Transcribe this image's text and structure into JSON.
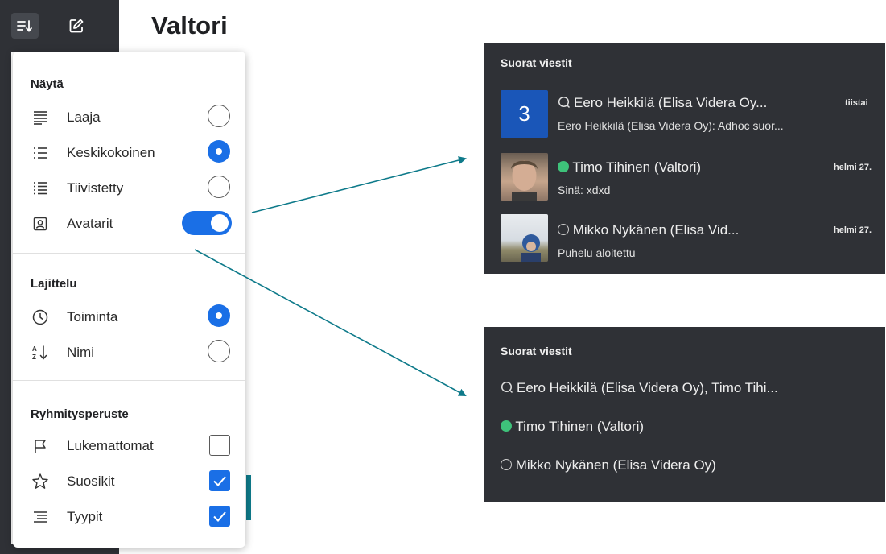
{
  "topbar": {
    "title": "Valtori",
    "sort_icon": "sort-icon",
    "compose_icon": "compose-icon"
  },
  "menu": {
    "sections": [
      {
        "title": "Näytä",
        "items": [
          {
            "label": "Laaja",
            "icon": "list-wide-icon",
            "control": "radio",
            "checked": false
          },
          {
            "label": "Keskikokoinen",
            "icon": "list-medium-icon",
            "control": "radio",
            "checked": true
          },
          {
            "label": "Tiivistetty",
            "icon": "list-compact-icon",
            "control": "radio",
            "checked": false
          },
          {
            "label": "Avatarit",
            "icon": "avatar-icon",
            "control": "toggle",
            "checked": true
          }
        ]
      },
      {
        "title": "Lajittelu",
        "items": [
          {
            "label": "Toiminta",
            "icon": "clock-icon",
            "control": "radio",
            "checked": true
          },
          {
            "label": "Nimi",
            "icon": "sort-az-icon",
            "control": "radio",
            "checked": false
          }
        ]
      },
      {
        "title": "Ryhmitysperuste",
        "items": [
          {
            "label": "Lukemattomat",
            "icon": "flag-icon",
            "control": "checkbox",
            "checked": false
          },
          {
            "label": "Suosikit",
            "icon": "star-icon",
            "control": "checkbox",
            "checked": true
          },
          {
            "label": "Tyypit",
            "icon": "types-icon",
            "control": "checkbox",
            "checked": true
          }
        ]
      }
    ]
  },
  "panel_top": {
    "header": "Suorat viestit",
    "items": [
      {
        "avatar_text": "3",
        "name": "Eero Heikkilä (Elisa Videra Oy...",
        "date": "tiistai",
        "preview": "Eero Heikkilä (Elisa Videra Oy): Adhoc suor...",
        "status": "group"
      },
      {
        "name": "Timo Tihinen (Valtori)",
        "date": "helmi 27.",
        "preview": "Sinä: xdxd",
        "status": "online"
      },
      {
        "name": "Mikko Nykänen (Elisa Vid...",
        "date": "helmi 27.",
        "preview": "Puhelu aloitettu",
        "status": "offline"
      }
    ]
  },
  "panel_bottom": {
    "header": "Suorat viestit",
    "items": [
      {
        "name": "Eero Heikkilä (Elisa Videra Oy), Timo Tihi...",
        "status": "group"
      },
      {
        "name": "Timo Tihinen (Valtori)",
        "status": "online"
      },
      {
        "name": "Mikko Nykänen (Elisa Videra Oy)",
        "status": "offline"
      }
    ]
  },
  "colors": {
    "accent": "#1a6fe6",
    "dark_panel": "#2f3136",
    "arrow": "#0e7a8a",
    "online": "#3ec27a"
  }
}
